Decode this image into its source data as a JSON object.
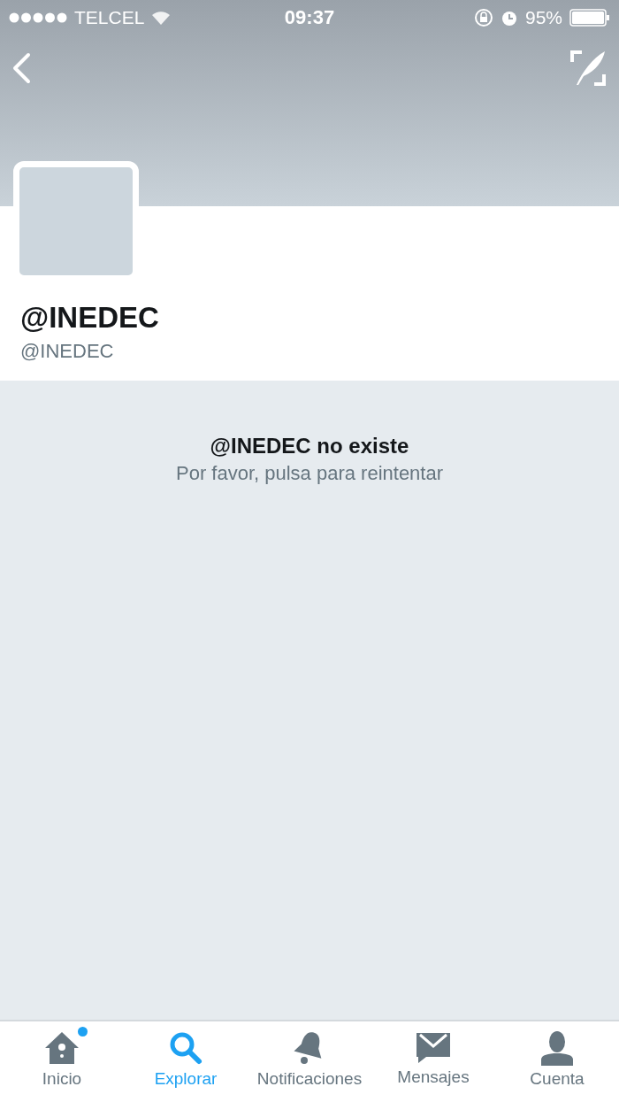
{
  "status_bar": {
    "carrier": "TELCEL",
    "time": "09:37",
    "battery": "95%"
  },
  "profile": {
    "display_name": "@INEDEC",
    "handle": "@INEDEC"
  },
  "message": {
    "title": "@INEDEC no existe",
    "subtitle": "Por favor, pulsa para reintentar"
  },
  "tab_bar": [
    {
      "kind": "home",
      "label": "Inicio",
      "selected": false,
      "dot": true
    },
    {
      "kind": "search",
      "label": "Explorar",
      "selected": true,
      "dot": false
    },
    {
      "kind": "bell",
      "label": "Notificaciones",
      "selected": false,
      "dot": false
    },
    {
      "kind": "mail",
      "label": "Mensajes",
      "selected": false,
      "dot": false
    },
    {
      "kind": "person",
      "label": "Cuenta",
      "selected": false,
      "dot": false
    }
  ]
}
